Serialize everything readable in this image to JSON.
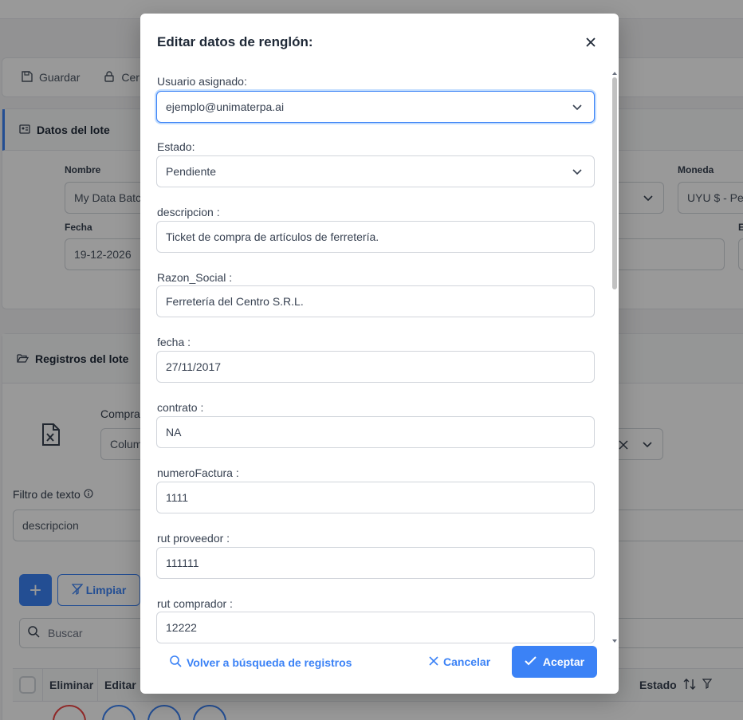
{
  "toolbar": {
    "save_label": "Guardar",
    "close_label": "Cer"
  },
  "batch_panel": {
    "title": "Datos del lote",
    "nombre_label": "Nombre",
    "nombre_value": "My Data Batch",
    "moneda_label": "Moneda",
    "moneda_value": "UYU $ - Pes",
    "fecha_label": "Fecha",
    "fecha_value": "19-12-2026",
    "extra_label": "E"
  },
  "records_panel": {
    "title": "Registros del lote",
    "compras_label": "Compras",
    "column_select": "Colum",
    "text_filter_label": "Filtro de texto",
    "text_filter_value": "descripcion",
    "clear_label": "Limpiar",
    "search_placeholder": "Buscar",
    "table_headers": {
      "delete": "Eliminar",
      "edit": "Editar",
      "status": "Estado"
    }
  },
  "modal": {
    "title": "Editar datos de renglón:",
    "fields": {
      "usuario": {
        "label": "Usuario asignado:",
        "value": "ejemplo@unimaterpa.ai"
      },
      "estado": {
        "label": "Estado:",
        "value": "Pendiente"
      },
      "descripcion": {
        "label": "descripcion :",
        "value": "Ticket de compra de artículos de ferretería."
      },
      "razon_social": {
        "label": "Razon_Social :",
        "value": "Ferretería del Centro S.R.L."
      },
      "fecha": {
        "label": "fecha :",
        "value": "27/11/2017"
      },
      "contrato": {
        "label": "contrato :",
        "value": "NA"
      },
      "numero_factura": {
        "label": "numeroFactura :",
        "value": "1111"
      },
      "rut_proveedor": {
        "label": "rut proveedor :",
        "value": "111111"
      },
      "rut_comprador": {
        "label": "rut comprador :",
        "value": "12222"
      }
    },
    "footer": {
      "back_label": "Volver a búsqueda de registros",
      "cancel_label": "Cancelar",
      "accept_label": "Aceptar"
    }
  },
  "colors": {
    "primary": "#3b82f6",
    "overlay": "rgba(0,0,0,0.4)"
  }
}
